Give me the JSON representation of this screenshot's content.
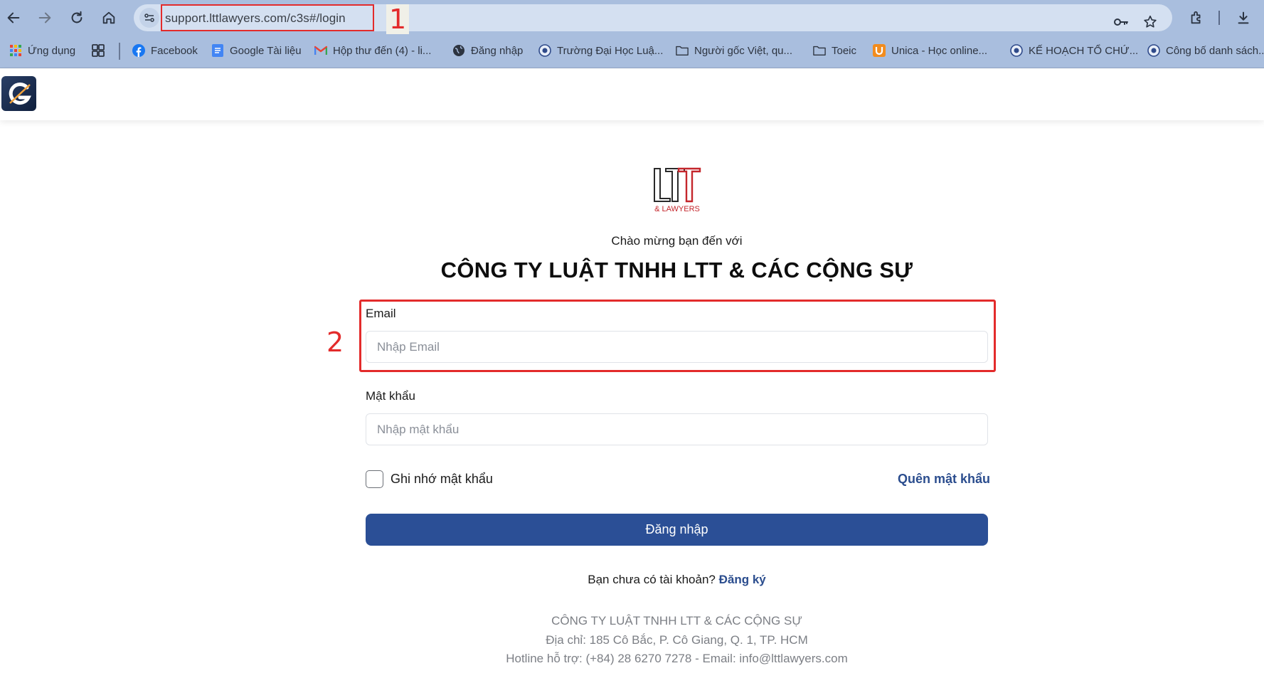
{
  "browser": {
    "url": "support.lttlawyers.com/c3s#/login",
    "markers": [
      "1",
      "2"
    ],
    "bookmarks": [
      {
        "label": "Ứng dụng",
        "icon": "apps-grid-icon"
      },
      {
        "label": "",
        "icon": "tab-groups-icon"
      },
      {
        "label": "Facebook",
        "icon": "facebook-icon"
      },
      {
        "label": "Google Tài liệu",
        "icon": "google-docs-icon"
      },
      {
        "label": "Hộp thư đến (4) - li...",
        "icon": "gmail-icon"
      },
      {
        "label": "Đăng nhập",
        "icon": "globe-icon"
      },
      {
        "label": "Trường Đại Học Luậ...",
        "icon": "university-seal-icon"
      },
      {
        "label": "Người gốc Việt, qu...",
        "icon": "folder-icon"
      },
      {
        "label": "Toeic",
        "icon": "folder-icon"
      },
      {
        "label": "Unica - Học online...",
        "icon": "unica-icon"
      },
      {
        "label": "KẾ HOẠCH TỔ CHỨ...",
        "icon": "university-seal-icon"
      },
      {
        "label": "Công bố danh sách...",
        "icon": "university-seal-icon"
      }
    ]
  },
  "brand": {
    "logo_letters": "LTT",
    "logo_sub": "& LAWYERS",
    "app_logo_letter": "G"
  },
  "login": {
    "welcome": "Chào mừng bạn đến với",
    "company": "CÔNG TY LUẬT TNHH LTT & CÁC CỘNG SỰ",
    "email_label": "Email",
    "email_placeholder": "Nhập Email",
    "password_label": "Mật khẩu",
    "password_placeholder": "Nhập mật khẩu",
    "remember_label": "Ghi nhớ mật khẩu",
    "forgot_label": "Quên mật khẩu",
    "submit_label": "Đăng nhập",
    "no_account_text": "Bạn chưa có tài khoản?",
    "register_label": "Đăng ký"
  },
  "footer": {
    "company": "CÔNG TY LUẬT TNHH LTT & CÁC CỘNG SỰ",
    "address": "Địa chỉ: 185 Cô Bắc, P. Cô Giang, Q. 1, TP. HCM",
    "contact": "Hotline hỗ trợ: (+84) 28 6270 7278 - Email: info@lttlawyers.com"
  },
  "colors": {
    "chrome": "#a9bede",
    "omnibox": "#d4e0f1",
    "annotation_red": "#e32b2b",
    "primary": "#2b4f96",
    "link": "#2b4d8e"
  }
}
